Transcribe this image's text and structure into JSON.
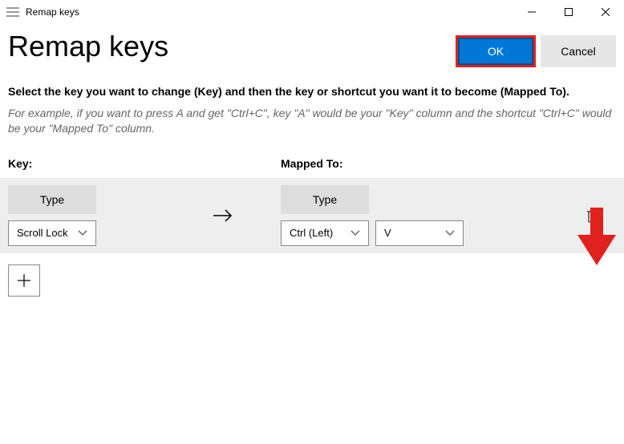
{
  "window": {
    "title": "Remap keys"
  },
  "page": {
    "title": "Remap keys",
    "ok_label": "OK",
    "cancel_label": "Cancel",
    "instruction": "Select the key you want to change (Key) and then the key or shortcut you want it to become (Mapped To).",
    "example": "For example, if you want to press A and get \"Ctrl+C\", key \"A\" would be your \"Key\" column and the shortcut \"Ctrl+C\" would be your \"Mapped To\" column."
  },
  "columns": {
    "key": "Key:",
    "mapped_to": "Mapped To:"
  },
  "row": {
    "type_label": "Type",
    "key_selected": "Scroll Lock",
    "mapped_key1": "Ctrl (Left)",
    "mapped_key2": "V"
  }
}
